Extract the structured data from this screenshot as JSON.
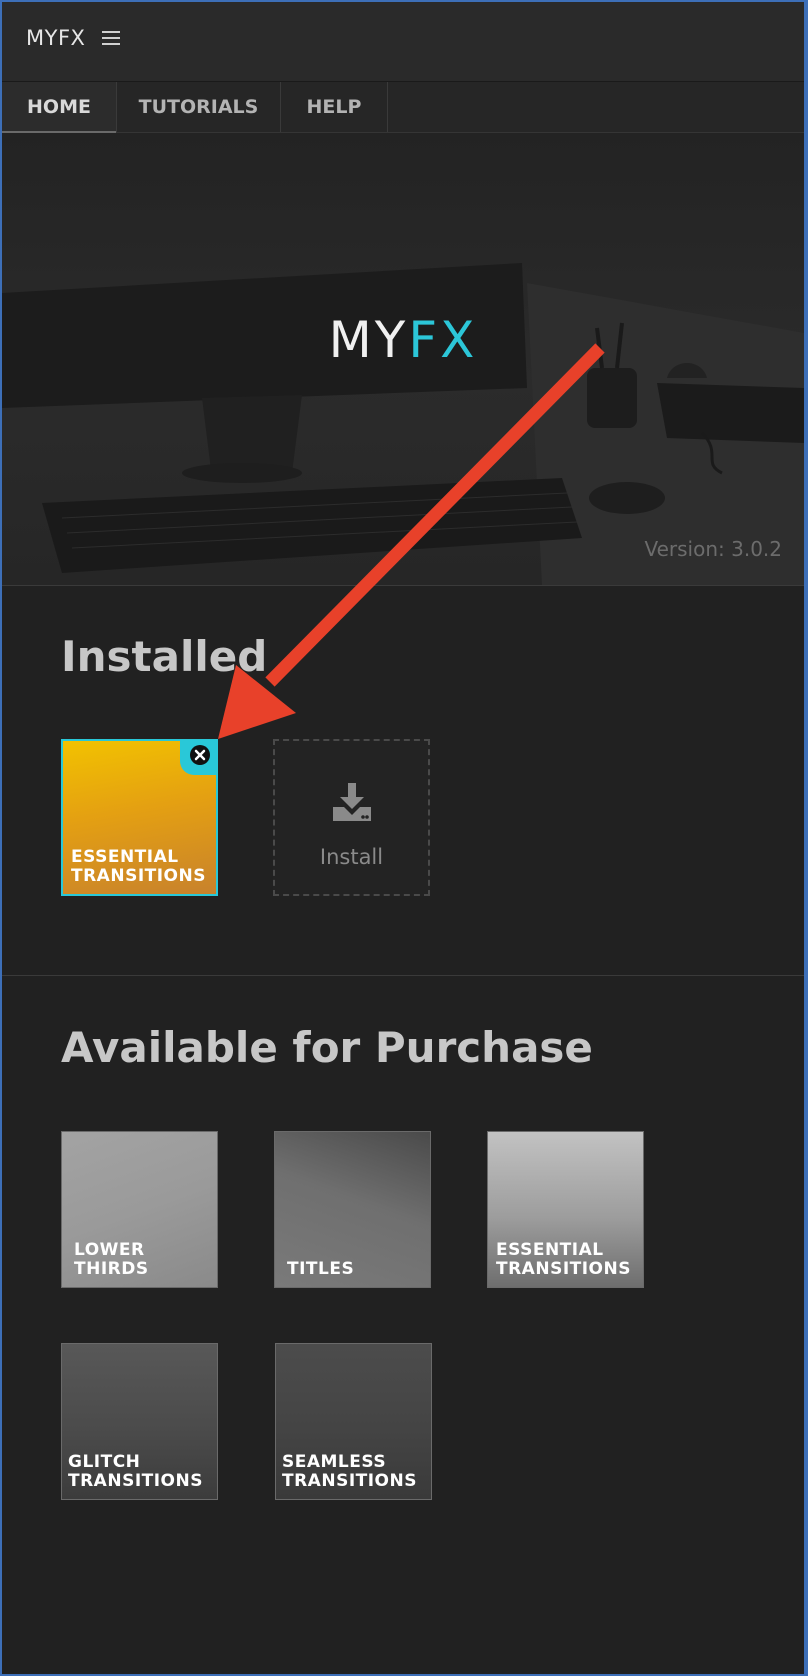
{
  "header": {
    "title": "MYFX"
  },
  "tabs": [
    {
      "label": "HOME",
      "active": true
    },
    {
      "label": "TUTORIALS",
      "active": false
    },
    {
      "label": "HELP",
      "active": false
    }
  ],
  "hero": {
    "logo_my": "MY",
    "logo_fx": "FX",
    "version": "Version: 3.0.2"
  },
  "installed": {
    "title": "Installed",
    "items": [
      {
        "label": "ESSENTIAL\nTRANSITIONS",
        "icon": "close-icon"
      }
    ],
    "install_label": "Install",
    "install_icon": "download-icon"
  },
  "purchase": {
    "title": "Available for Purchase",
    "items": [
      {
        "label": "LOWER\nTHIRDS"
      },
      {
        "label": "TITLES"
      },
      {
        "label": "ESSENTIAL\nTRANSITIONS"
      },
      {
        "label": "GLITCH\nTRANSITIONS"
      },
      {
        "label": "SEAMLESS\nTRANSITIONS"
      }
    ]
  },
  "colors": {
    "accent": "#29c8d8",
    "annotation_arrow": "#e8412a",
    "background": "#212121"
  }
}
